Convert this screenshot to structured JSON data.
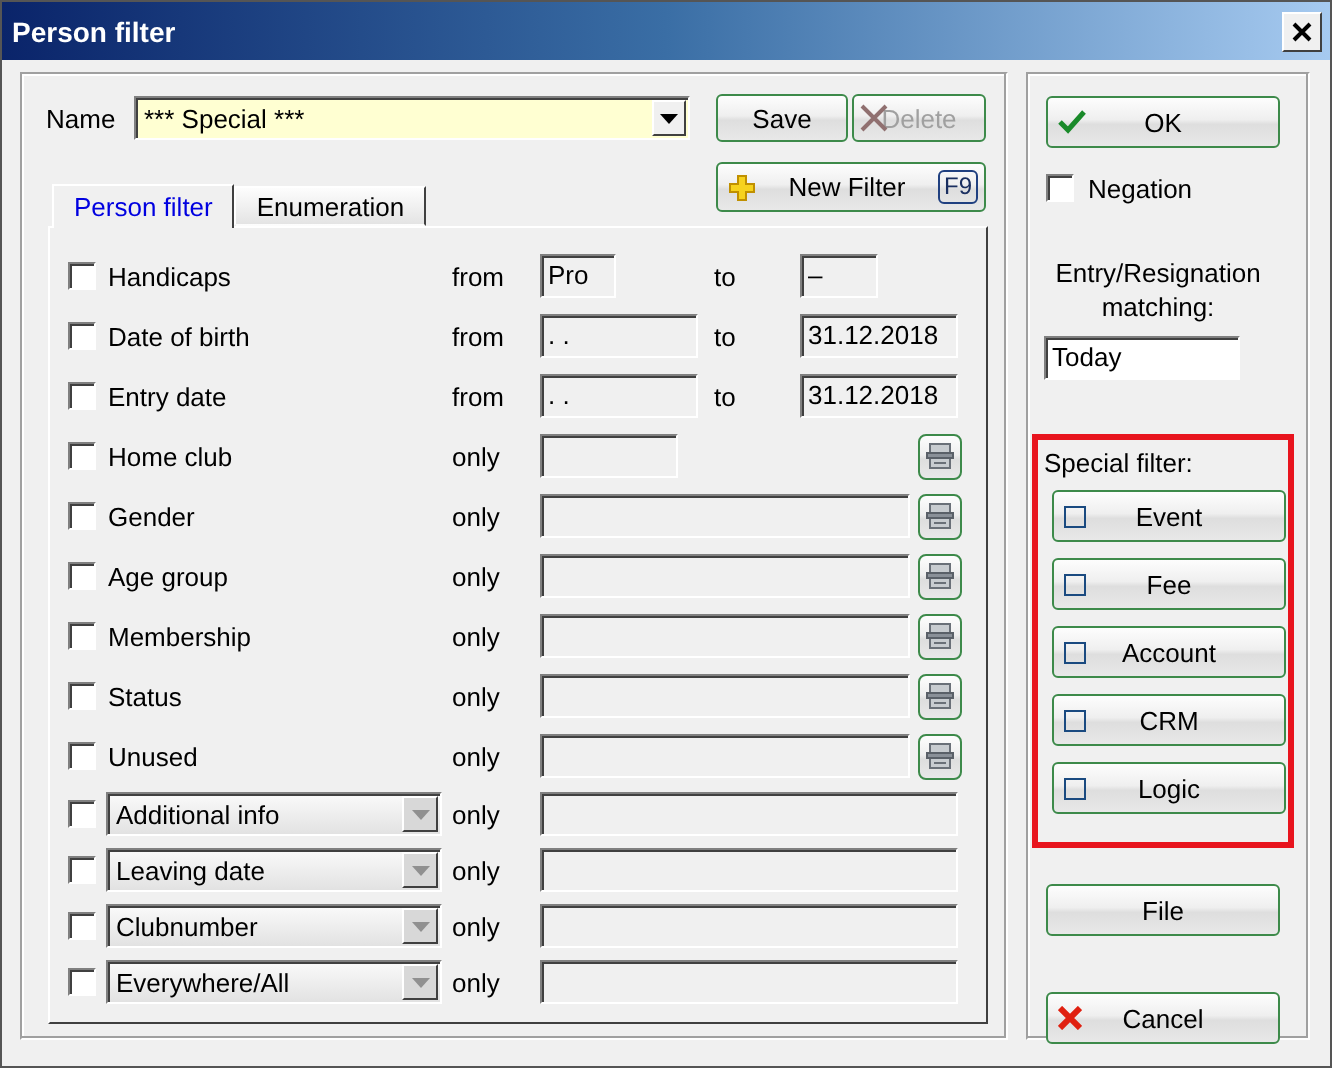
{
  "window": {
    "title": "Person filter"
  },
  "name_field": {
    "label": "Name",
    "value": "*** Special ***"
  },
  "buttons": [
    {
      "kind": "save",
      "label": "Save",
      "disabled": false
    },
    {
      "kind": "delete",
      "label": "Delete",
      "disabled": true
    }
  ],
  "new_filter": {
    "label": "New Filter",
    "shortcut": "F9"
  },
  "tabs": [
    {
      "label": "Person filter",
      "selected": true
    },
    {
      "label": "Enumeration",
      "selected": false
    }
  ],
  "filters": [
    {
      "kind": "range-short",
      "label": "Handicaps",
      "checked": false,
      "operator": "from",
      "from": "Pro",
      "to_label": "to",
      "to": "–"
    },
    {
      "kind": "range",
      "label": "Date of birth",
      "checked": false,
      "operator": "from",
      "from": ". .",
      "to_label": "to",
      "to": "31.12.2018"
    },
    {
      "kind": "range",
      "label": "Entry date",
      "checked": false,
      "operator": "from",
      "from": ". .",
      "to_label": "to",
      "to": "31.12.2018"
    },
    {
      "kind": "pick-short",
      "label": "Home club",
      "checked": false,
      "operator": "only"
    },
    {
      "kind": "pick",
      "label": "Gender",
      "checked": false,
      "operator": "only"
    },
    {
      "kind": "pick",
      "label": "Age group",
      "checked": false,
      "operator": "only"
    },
    {
      "kind": "pick",
      "label": "Membership",
      "checked": false,
      "operator": "only"
    },
    {
      "kind": "pick",
      "label": "Status",
      "checked": false,
      "operator": "only"
    },
    {
      "kind": "pick",
      "label": "Unused",
      "checked": false,
      "operator": "only"
    },
    {
      "kind": "select",
      "label": "Additional info",
      "checked": false,
      "operator": "only"
    },
    {
      "kind": "select",
      "label": "Leaving date",
      "checked": false,
      "operator": "only"
    },
    {
      "kind": "select",
      "label": "Clubnumber",
      "checked": false,
      "operator": "only"
    },
    {
      "kind": "select",
      "label": "Everywhere/All",
      "checked": false,
      "operator": "only"
    }
  ],
  "side": {
    "ok": "OK",
    "negation": {
      "label": "Negation",
      "checked": false
    },
    "matching_label": "Entry/Resignation matching:",
    "matching_value": "Today",
    "special_filter": {
      "title": "Special filter:",
      "highlighted": true,
      "buttons": [
        {
          "label": "Event",
          "checked": false
        },
        {
          "label": "Fee",
          "checked": false
        },
        {
          "label": "Account",
          "checked": false
        },
        {
          "label": "CRM",
          "checked": false
        },
        {
          "label": "Logic",
          "checked": false
        }
      ]
    },
    "file": "File",
    "cancel": "Cancel"
  }
}
